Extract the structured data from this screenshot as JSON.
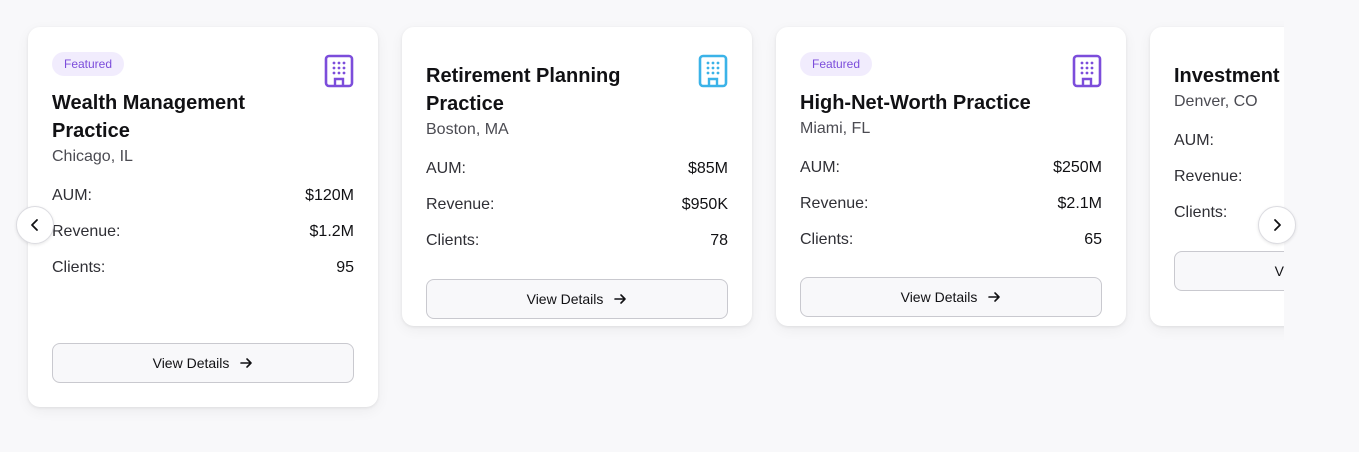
{
  "carousel": {
    "prev_icon": "chevron-left-icon",
    "next_icon": "chevron-right-icon",
    "cards": [
      {
        "badge": "Featured",
        "title": "Wealth Management Practice",
        "location": "Chicago, IL",
        "icon": "building-icon",
        "icon_color": "#7c4ddb",
        "stats": [
          {
            "label": "AUM:",
            "value": "$120M"
          },
          {
            "label": "Revenue:",
            "value": "$1.2M"
          },
          {
            "label": "Clients:",
            "value": "95"
          }
        ],
        "button_label": "View Details"
      },
      {
        "badge": "",
        "title": "Retirement Planning Practice",
        "location": "Boston, MA",
        "icon": "building-icon",
        "icon_color": "#3bb3e8",
        "stats": [
          {
            "label": "AUM:",
            "value": "$85M"
          },
          {
            "label": "Revenue:",
            "value": "$950K"
          },
          {
            "label": "Clients:",
            "value": "78"
          }
        ],
        "button_label": "View Details"
      },
      {
        "badge": "Featured",
        "title": "High-Net-Worth Practice",
        "location": "Miami, FL",
        "icon": "building-icon",
        "icon_color": "#7c4ddb",
        "stats": [
          {
            "label": "AUM:",
            "value": "$250M"
          },
          {
            "label": "Revenue:",
            "value": "$2.1M"
          },
          {
            "label": "Clients:",
            "value": "65"
          }
        ],
        "button_label": "View Details"
      },
      {
        "badge": "",
        "title": "Investment",
        "location": "Denver, CO",
        "icon": "building-icon",
        "icon_color": "#7c4ddb",
        "stats": [
          {
            "label": "AUM:",
            "value": ""
          },
          {
            "label": "Revenue:",
            "value": ""
          },
          {
            "label": "Clients:",
            "value": ""
          }
        ],
        "button_label": "View Details"
      }
    ]
  }
}
